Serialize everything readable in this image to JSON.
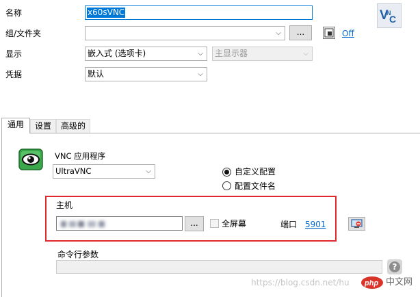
{
  "form": {
    "name_label": "名称",
    "name_value": "x60sVNC",
    "group_label": "组/文件夹",
    "group_value": "",
    "group_browse_label": "...",
    "group_toggle_label": "Off",
    "display_label": "显示",
    "display_mode_value": "嵌入式 (选项卡)",
    "display_monitor_value": "主显示器",
    "credentials_label": "凭据",
    "credentials_value": "默认"
  },
  "tabs": [
    {
      "label": "通用"
    },
    {
      "label": "设置"
    },
    {
      "label": "高级的"
    }
  ],
  "general": {
    "vnc_app_label": "VNC 应用程序",
    "vnc_app_value": "UltraVNC",
    "radio_custom_label": "自定义配置",
    "radio_profile_label": "配置文件名",
    "host_label": "主机",
    "host_browse_label": "...",
    "fullscreen_label": "全屏幕",
    "port_label": "端口",
    "port_value": "5901",
    "cmdline_label": "命令行参数",
    "cmdline_value": "",
    "help_label": "?"
  },
  "watermark": {
    "url_text": "https://blog.csdn.net/hu",
    "site_text": "中文网"
  },
  "colors": {
    "selection": "#0078d7",
    "highlight_border": "#e0282e",
    "link": "#0066cc",
    "app_icon_green": "#3aa84a"
  }
}
